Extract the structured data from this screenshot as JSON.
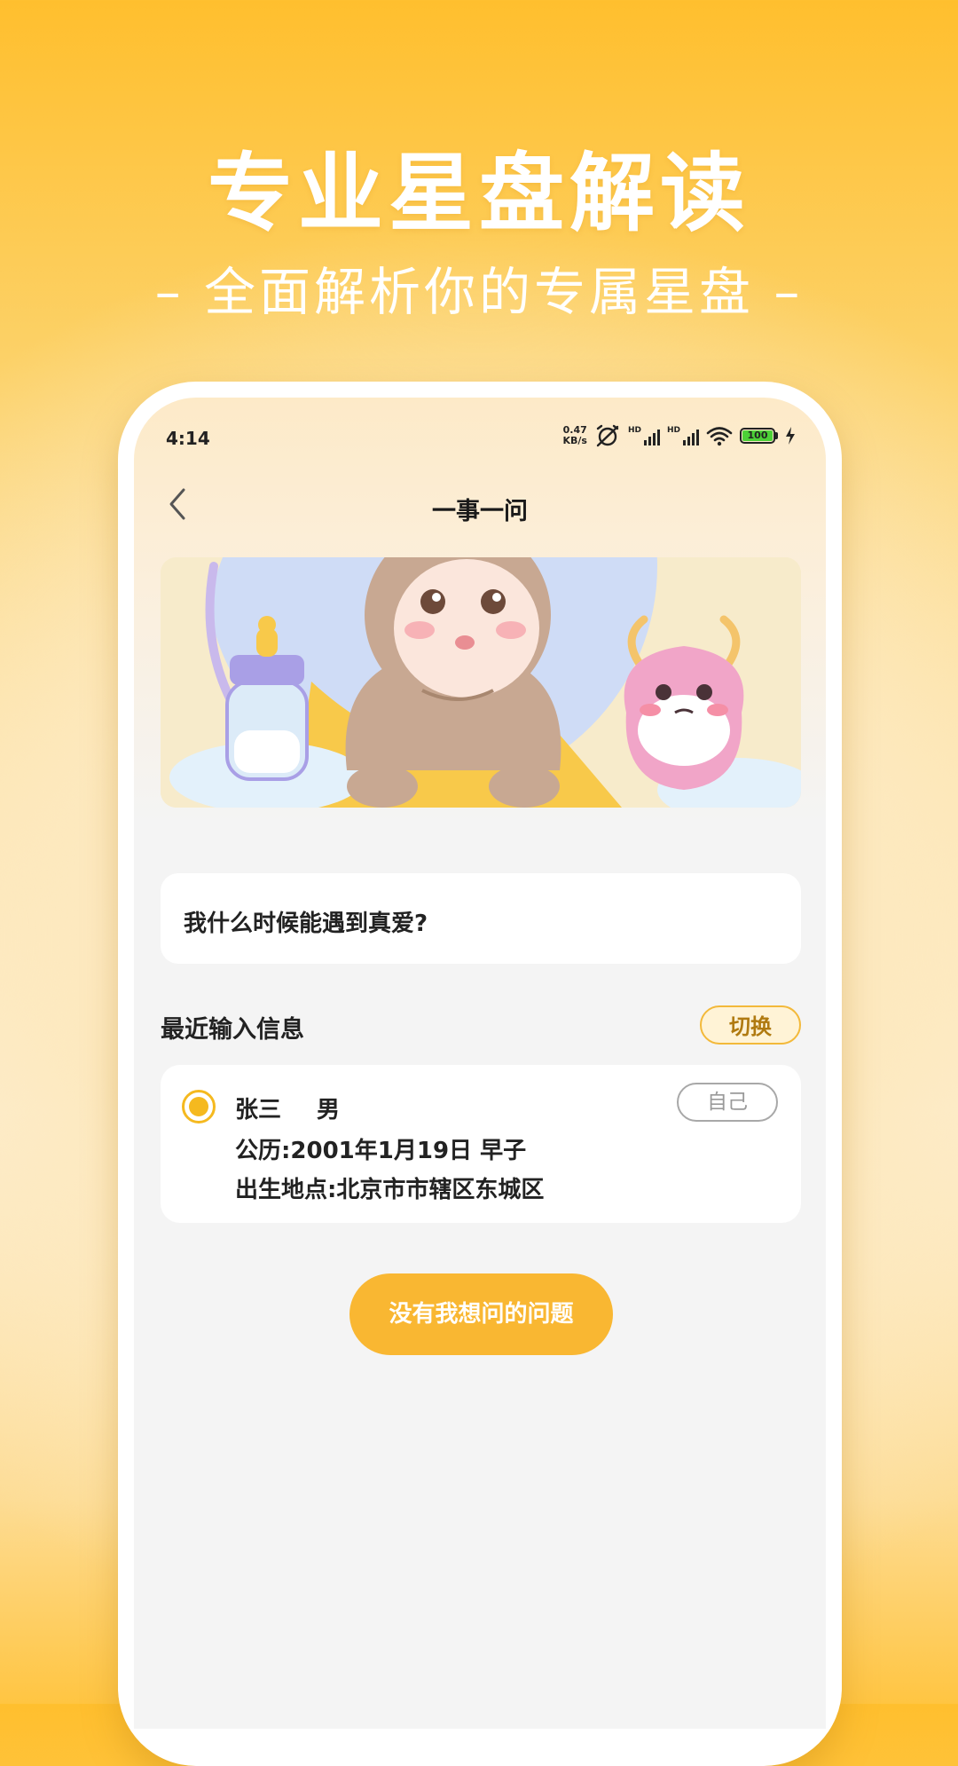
{
  "promo": {
    "title": "专业星盘解读",
    "subtitle": "– 全面解析你的专属星盘 –"
  },
  "status_bar": {
    "time": "4:14",
    "net_speed_value": "0.47",
    "net_speed_unit": "KB/s",
    "signal_label": "HD",
    "battery_level": "100"
  },
  "header": {
    "title": "一事一问",
    "back_icon": "chevron-left-icon"
  },
  "question": {
    "text": "我什么时候能遇到真爱?"
  },
  "recent": {
    "title": "最近输入信息",
    "switch_label": "切换"
  },
  "profile": {
    "name": "张三",
    "gender": "男",
    "birth": "公历:2001年1月19日 早子",
    "place": "出生地点:北京市市辖区东城区",
    "tag": "自己",
    "selected": true
  },
  "actions": {
    "no_question_label": "没有我想问的问题"
  },
  "colors": {
    "accent": "#f9b732",
    "accent_border": "#f3b93a",
    "battery": "#4cd137"
  }
}
